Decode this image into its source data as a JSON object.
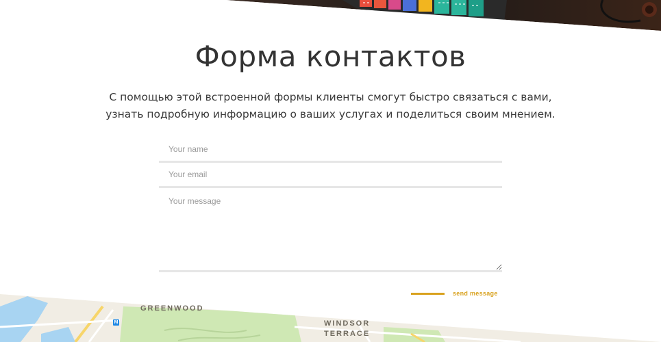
{
  "section": {
    "title": "Форма контактов",
    "description": "С помощью этой встроенной формы клиенты смогут быстро связаться с вами, узнать подробную информацию о ваших услугах и поделиться своим мнением."
  },
  "form": {
    "name_placeholder": "Your name",
    "email_placeholder": "Your email",
    "message_placeholder": "Your message",
    "send_label": "send message"
  },
  "map": {
    "label_1": "GREENWOOD",
    "label_2": "WINDSOR",
    "label_3": "TERRACE",
    "metro_icon": "M"
  },
  "colors": {
    "accent": "#d9a21f",
    "field_border": "#e6e6e6",
    "title": "#333333"
  }
}
